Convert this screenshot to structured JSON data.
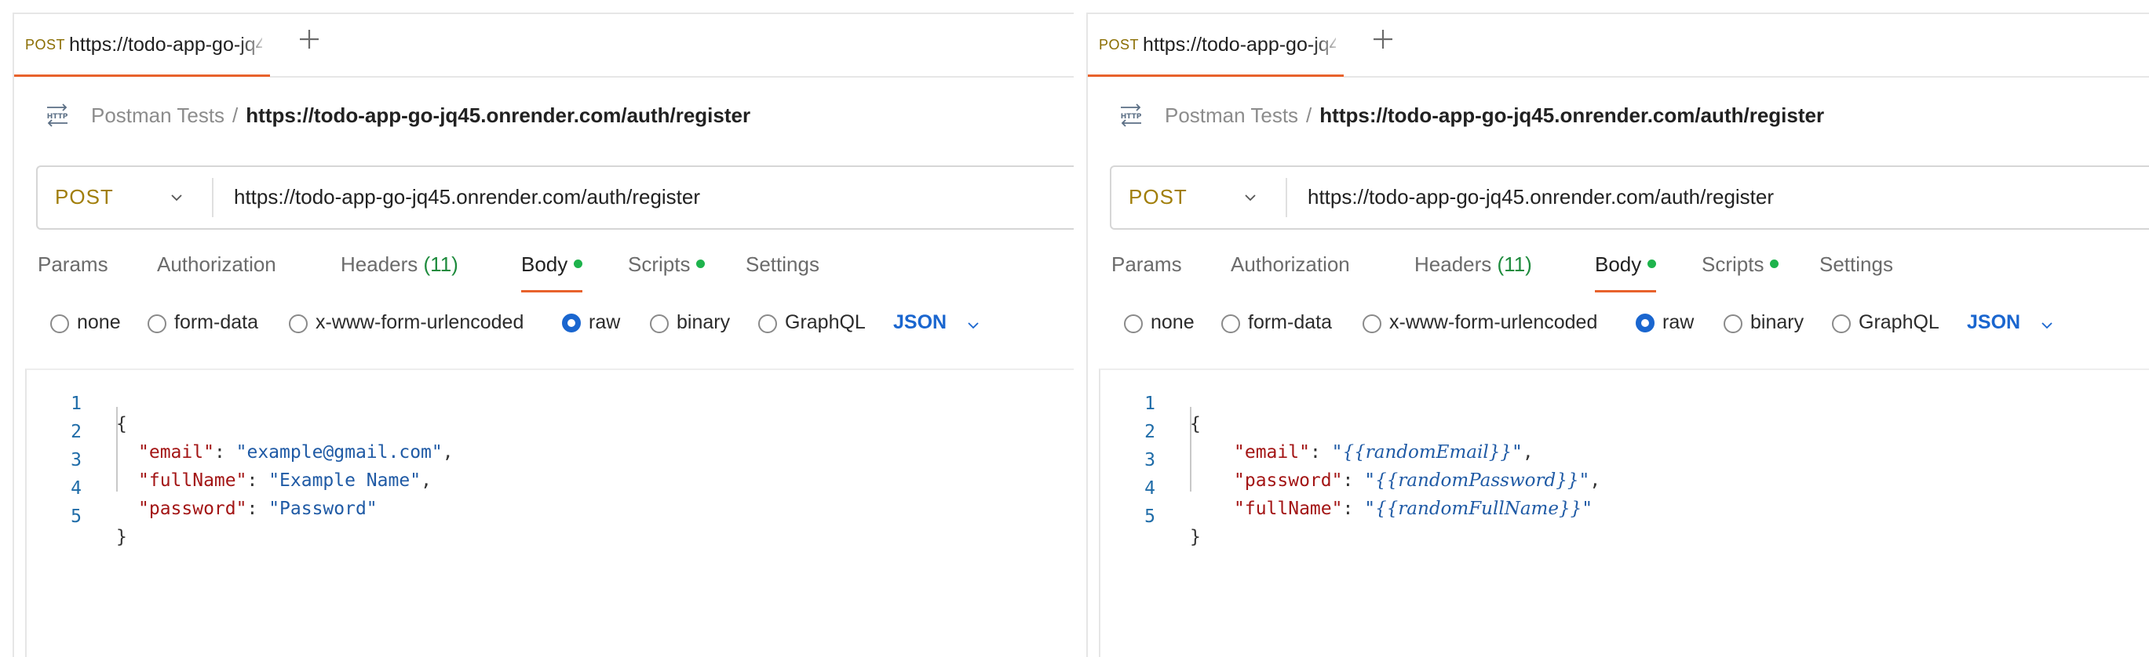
{
  "panels": [
    {
      "tab": {
        "method": "POST",
        "title": "https://todo-app-go-jq45.onrender.com/auth/register"
      },
      "breadcrumb": {
        "collection": "Postman Tests",
        "separator": "/",
        "current": "https://todo-app-go-jq45.onrender.com/auth/register"
      },
      "request": {
        "method": "POST",
        "url": "https://todo-app-go-jq45.onrender.com/auth/register"
      },
      "tabs": {
        "params": "Params",
        "authorization": "Authorization",
        "headers": "Headers",
        "headers_count": "(11)",
        "body": "Body",
        "scripts": "Scripts",
        "settings": "Settings",
        "active": "Body"
      },
      "body_types": {
        "none": "none",
        "form_data": "form-data",
        "urlencoded": "x-www-form-urlencoded",
        "raw": "raw",
        "binary": "binary",
        "graphql": "GraphQL",
        "selected": "raw",
        "format": "JSON"
      },
      "code": {
        "line_numbers": [
          "1",
          "2",
          "3",
          "4",
          "5"
        ],
        "open_brace": "{",
        "close_brace": "}",
        "fields": [
          {
            "key": "\"email\"",
            "colon": ": ",
            "value": "\"example@gmail.com\"",
            "trail": ","
          },
          {
            "key": "\"fullName\"",
            "colon": ": ",
            "value": "\"Example Name\"",
            "trail": ","
          },
          {
            "key": "\"password\"",
            "colon": ": ",
            "value": "\"Password\"",
            "trail": ""
          }
        ]
      }
    },
    {
      "tab": {
        "method": "POST",
        "title": "https://todo-app-go-jq45.onrender.com/auth/register"
      },
      "breadcrumb": {
        "collection": "Postman Tests",
        "separator": "/",
        "current": "https://todo-app-go-jq45.onrender.com/auth/register"
      },
      "request": {
        "method": "POST",
        "url": "https://todo-app-go-jq45.onrender.com/auth/register"
      },
      "tabs": {
        "params": "Params",
        "authorization": "Authorization",
        "headers": "Headers",
        "headers_count": "(11)",
        "body": "Body",
        "scripts": "Scripts",
        "settings": "Settings",
        "active": "Body"
      },
      "body_types": {
        "none": "none",
        "form_data": "form-data",
        "urlencoded": "x-www-form-urlencoded",
        "raw": "raw",
        "binary": "binary",
        "graphql": "GraphQL",
        "selected": "raw",
        "format": "JSON"
      },
      "code": {
        "line_numbers": [
          "1",
          "2",
          "3",
          "4",
          "5"
        ],
        "open_brace": "{",
        "close_brace": "}",
        "fields": [
          {
            "key": "\"email\"",
            "colon": ": ",
            "q1": "\"",
            "var": "{{randomEmail}}",
            "q2": "\"",
            "trail": ","
          },
          {
            "key": "\"password\"",
            "colon": ": ",
            "q1": "\"",
            "var": "{{randomPassword}}",
            "q2": "\"",
            "trail": ","
          },
          {
            "key": "\"fullName\"",
            "colon": ": ",
            "q1": "\"",
            "var": "{{randomFullName}}",
            "q2": "\"",
            "trail": ""
          }
        ]
      }
    }
  ],
  "colors": {
    "accent": "#e8622c",
    "method": "#a17e08",
    "radio_selected": "#1a66cf",
    "status_dot": "#1eb34c",
    "json_key": "#a31515",
    "json_string": "#1f5aa5"
  },
  "icons": {
    "http": "http-icon",
    "add_tab": "plus-icon",
    "dropdown": "chevron-down-icon"
  }
}
